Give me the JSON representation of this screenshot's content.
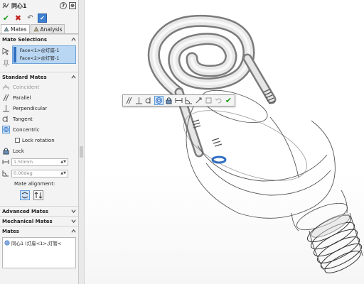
{
  "panel": {
    "title": "同心1",
    "tabs": [
      {
        "label": "Mates",
        "active": true
      },
      {
        "label": "Analysis",
        "active": false
      }
    ],
    "mate_selections": {
      "heading": "Mate Selections",
      "items": [
        "Face<1>@灯座-1",
        "Face<2>@灯管-1"
      ]
    },
    "standard_mates": {
      "heading": "Standard Mates",
      "items": [
        {
          "label": "Coincident",
          "state": "disabled"
        },
        {
          "label": "Parallel",
          "state": "normal"
        },
        {
          "label": "Perpendicular",
          "state": "normal"
        },
        {
          "label": "Tangent",
          "state": "normal"
        },
        {
          "label": "Concentric",
          "state": "selected"
        }
      ],
      "lock_rotation": "Lock rotation",
      "lock": "Lock",
      "distance_value": "1.50mm",
      "angle_value": "0.00deg",
      "mate_alignment": "Mate alignment:"
    },
    "advanced_mates": "Advanced Mates",
    "mechanical_mates": "Mechanical Mates",
    "mates_section": {
      "heading": "Mates",
      "items": [
        "同心1 (灯座<1>,灯管<"
      ]
    }
  },
  "colors": {
    "accent": "#3f7fd1",
    "selection_fill": "#b9d6f2",
    "ok_green": "#1a9b1a",
    "cancel_red": "#c21e1e",
    "highlight_blue": "#2f6fc4"
  },
  "icons": {
    "title": "concentric-mate-icon",
    "ok": "check-icon",
    "cancel": "x-icon",
    "undo": "undo-icon",
    "pin": "pushpin-icon"
  }
}
